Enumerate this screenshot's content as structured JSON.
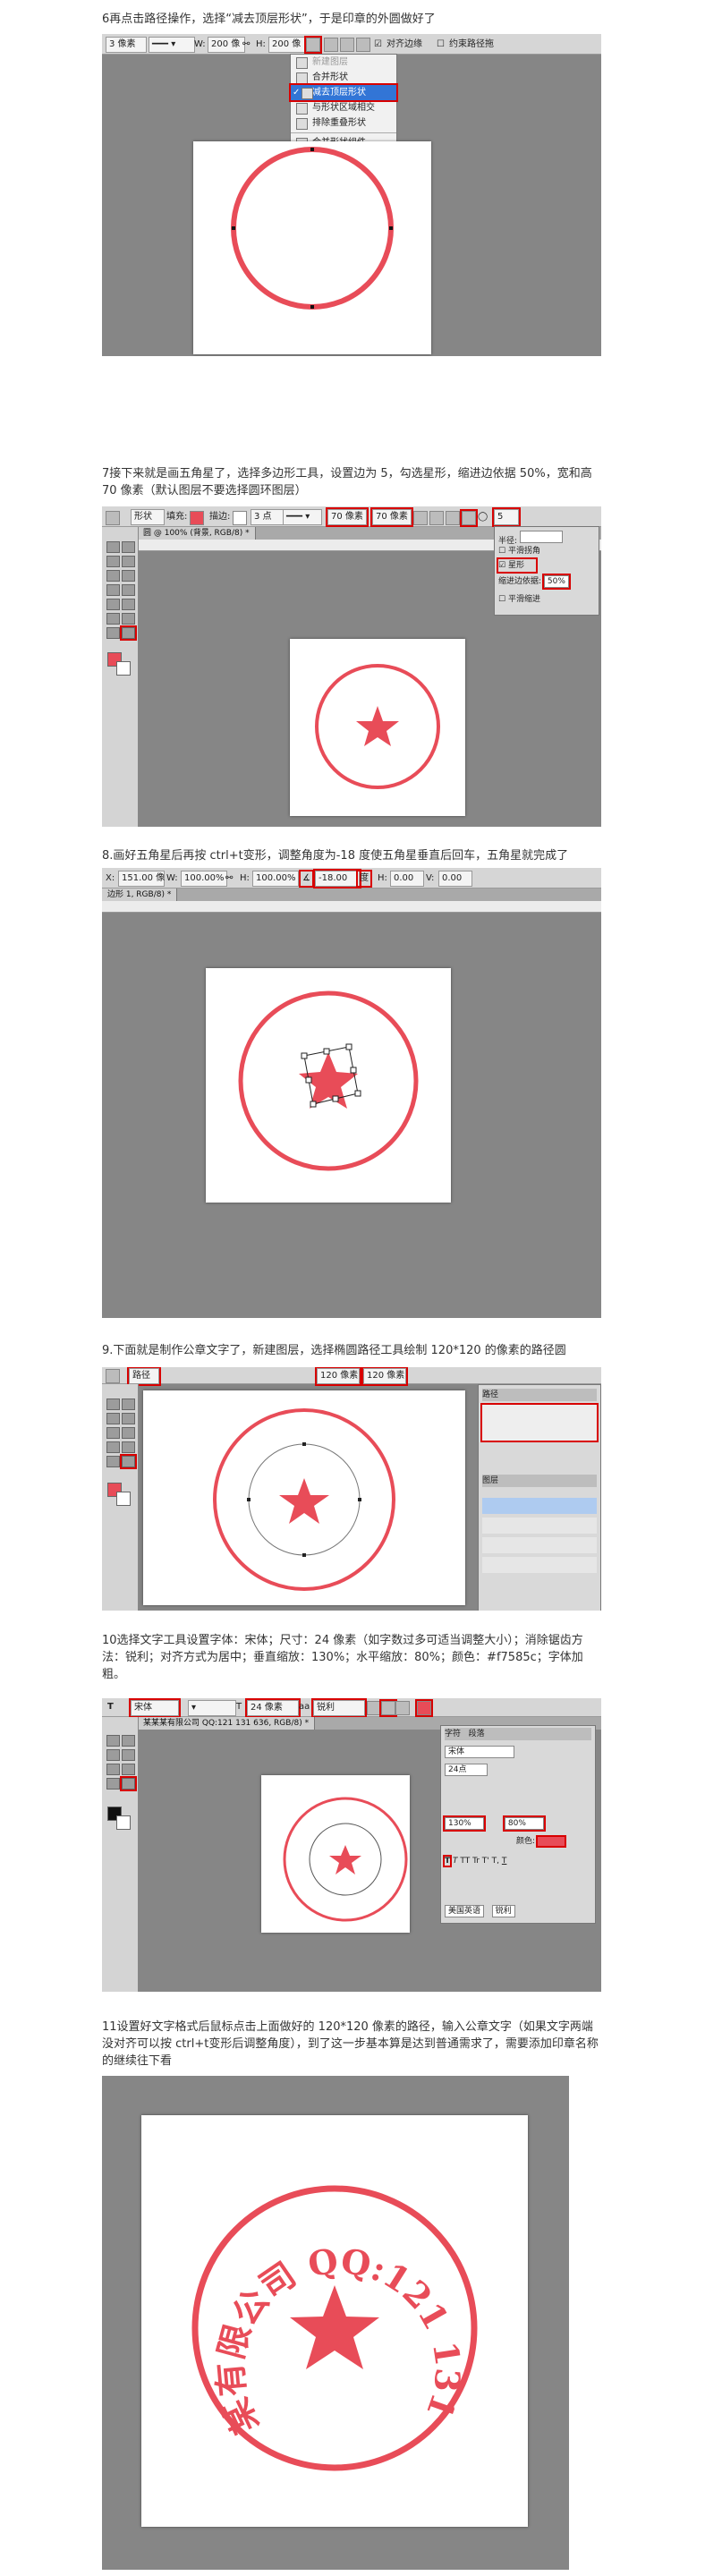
{
  "steps": [
    {
      "text": "6再点击路径操作，选择“减去顶层形状”，于是印章的外圆做好了"
    },
    {
      "text": "7接下来就是画五角星了，选择多边形工具，设置边为 5，勾选星形，缩进边依据 50%，宽和高 70 像素（默认图层不要选择圆环图层）"
    },
    {
      "text": "8.画好五角星后再按 ctrl+t变形，调整角度为-18 度使五角星垂直后回车，五角星就完成了"
    },
    {
      "text": "9.下面就是制作公章文字了，新建图层，选择椭圆路径工具绘制 120*120 的像素的路径圆"
    },
    {
      "text": "10选择文字工具设置字体：宋体；尺寸：24 像素（如字数过多可适当调整大小）；消除锯齿方法：锐利；对齐方式为居中；垂直缩放：130%；水平缩放：80%；颜色：#f7585c；字体加粗。"
    },
    {
      "text": "11设置好文字格式后鼠标点击上面做好的 120*120 像素的路径，输入公章文字（如果文字两端没对齐可以按 ctrl+t变形后调整角度），到了这一步基本算是达到普通需求了，需要添加印章名称的继续往下看"
    }
  ],
  "shot1": {
    "stroke_size": "3 像素",
    "w_label": "W:",
    "w_value": "200 像",
    "h_label": "H:",
    "h_value": "200 像",
    "align_edges_label": "对齐边缘",
    "constrain_label": "约束路径拖",
    "menu": [
      {
        "label": "新建图层",
        "selected": false,
        "disabled": true
      },
      {
        "label": "合并形状",
        "selected": false,
        "disabled": false
      },
      {
        "label": "减去顶层形状",
        "selected": true,
        "disabled": false
      },
      {
        "label": "与形状区域相交",
        "selected": false,
        "disabled": false
      },
      {
        "label": "排除重叠形状",
        "selected": false,
        "disabled": false
      },
      {
        "label": "合并形状组件",
        "selected": false,
        "disabled": false
      }
    ]
  },
  "shot2": {
    "mode": "形状",
    "fill_label": "填充:",
    "stroke_label": "描边:",
    "stroke_size": "3 点",
    "w_value": "70 像素",
    "h_value": "70 像素",
    "sides_value": "5",
    "tab_title": "圆 @ 100% (背景, RGB/8) *",
    "panel_radius_label": "半径:",
    "panel_smooth_corners": "平滑拐角",
    "panel_star": "星形",
    "panel_indent_label": "缩进边依据:",
    "panel_indent_value": "50%",
    "panel_smooth_indent": "平滑缩进"
  },
  "shot3": {
    "x_value": "151.00 像",
    "w_label": "W:",
    "w_value": "100.00%",
    "h_label": "H:",
    "h_value": "100.00%",
    "angle_value": "-18.00",
    "angle_unit": "度",
    "hskew_label": "H:",
    "hskew_value": "0.00",
    "vskew_label": "V:",
    "vskew_value": "0.00",
    "tab_title": "边形 1, RGB/8) *"
  },
  "shot4": {
    "mode": "路径",
    "w_value": "120 像素",
    "h_value": "120 像素",
    "panel_items": [
      "路径",
      "图层"
    ]
  },
  "shot5": {
    "font_family": "宋体",
    "font_size": "24 像素",
    "antialias": "锐利",
    "tab_title": "某某某有限公司 QQ:121 131 636, RGB/8) *",
    "panel_tabs": [
      "字符",
      "段落"
    ],
    "panel_font": "宋体",
    "panel_size": "24点",
    "panel_vscale": "130%",
    "panel_hscale": "80%",
    "panel_color_label": "颜色:",
    "panel_lang": "美国英语",
    "panel_aa": "锐利"
  },
  "stamp": {
    "text": "某某某有限公司 QQ:121 131 636",
    "color": "#e84c58"
  },
  "colors": {
    "accent": "#e84c58",
    "highlight": "#d80000",
    "menu_select": "#3275d6"
  }
}
